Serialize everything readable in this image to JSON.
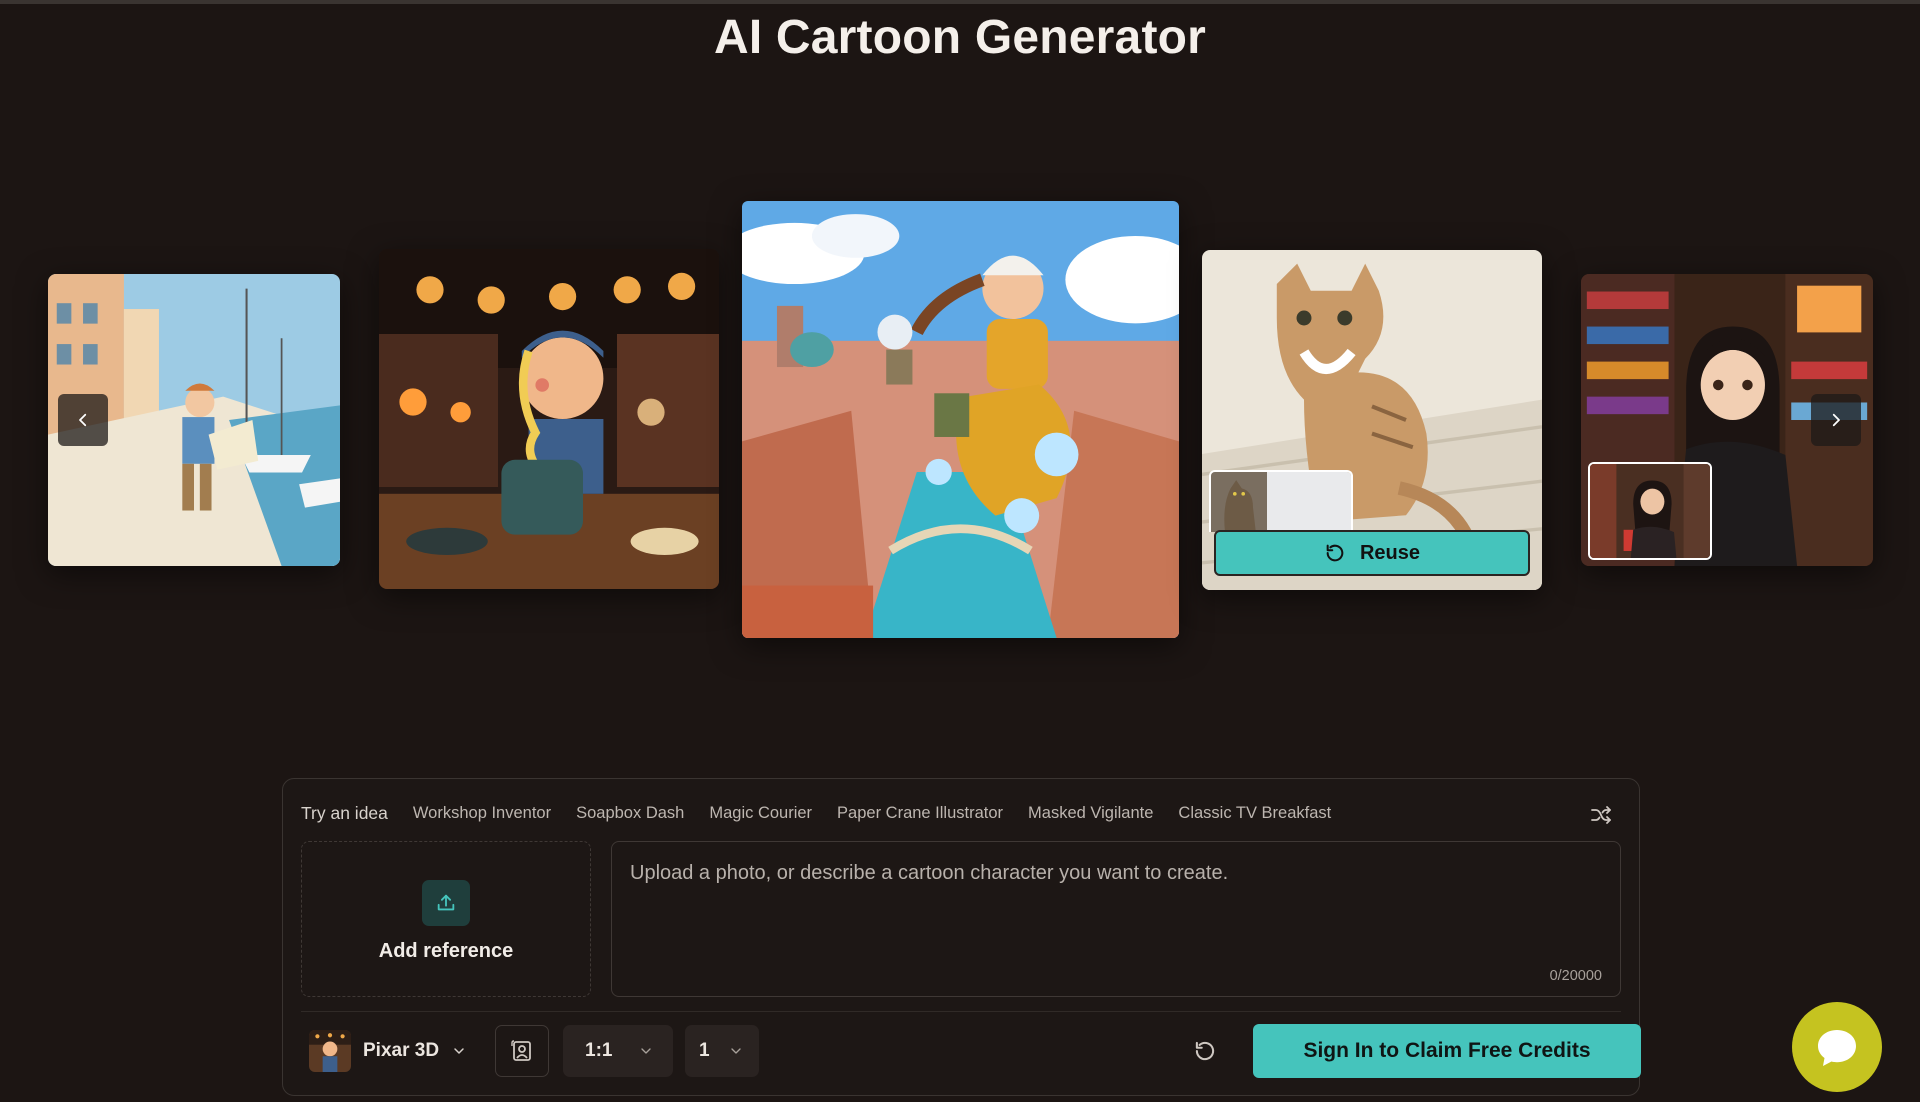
{
  "page": {
    "title": "AI Cartoon Generator"
  },
  "carousel": {
    "reuse_label": "Reuse"
  },
  "ideas": {
    "lead": "Try an idea",
    "items": [
      "Workshop Inventor",
      "Soapbox Dash",
      "Magic Courier",
      "Paper Crane Illustrator",
      "Masked Vigilante",
      "Classic TV Breakfast"
    ]
  },
  "reference": {
    "label": "Add reference"
  },
  "prompt": {
    "placeholder": "Upload a photo, or describe a cartoon character you want to create.",
    "value": "",
    "counter": "0/20000"
  },
  "toolbar": {
    "model": "Pixar 3D",
    "ratio": "1:1",
    "count": "1",
    "signin_label": "Sign In to Claim Free Credits"
  },
  "colors": {
    "accent": "#45c4bc",
    "background": "#1c1513",
    "chat": "#c5c320"
  }
}
